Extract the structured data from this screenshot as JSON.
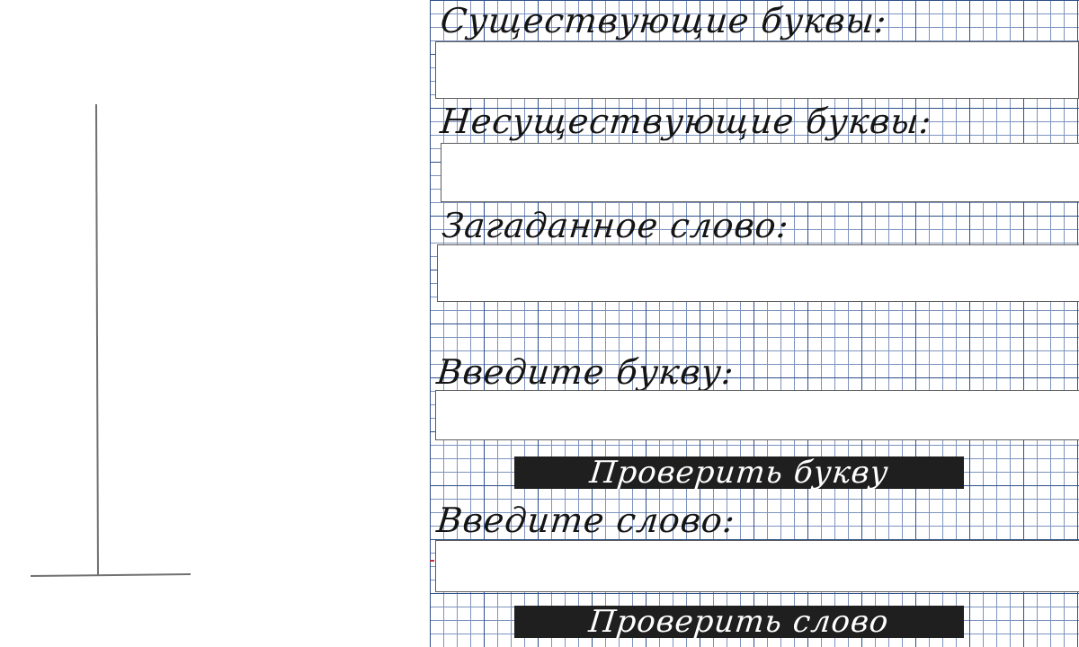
{
  "sections": {
    "existing_letters": {
      "label": "Существующие буквы:",
      "value": ""
    },
    "nonexistent_letters": {
      "label": "Несуществующие буквы:",
      "value": ""
    },
    "secret_word": {
      "label": "Загаданное слово:",
      "value": ""
    },
    "letter_entry": {
      "label": "Введите букву:",
      "value": "",
      "placeholder": ""
    },
    "word_entry": {
      "label": "Введите слово:",
      "value": "",
      "placeholder": ""
    }
  },
  "buttons": {
    "check_letter": "Проверить букву",
    "check_word": "Проверить слово"
  },
  "colors": {
    "grid_major": "#2e4f8a",
    "grid_minor": "#7d93bd",
    "button_bg": "#1f1f1f",
    "gallows_line": "#707070"
  }
}
